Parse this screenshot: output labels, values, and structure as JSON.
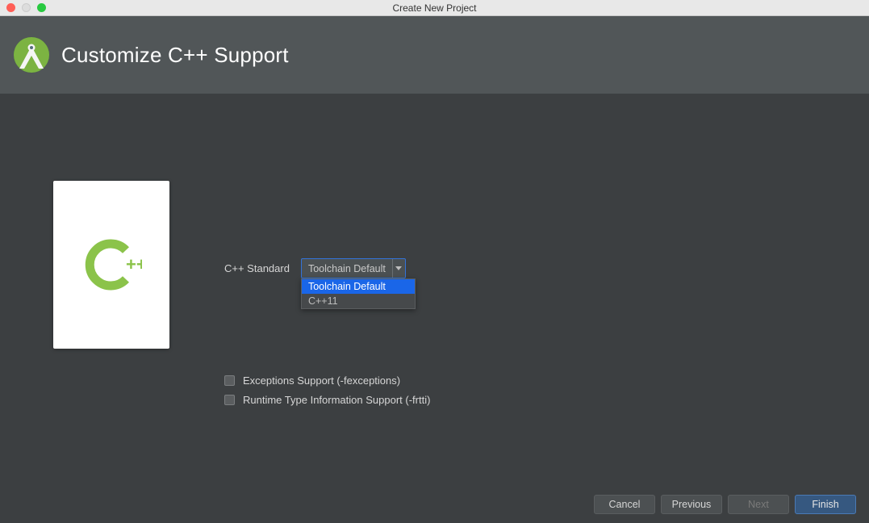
{
  "window": {
    "title": "Create New Project"
  },
  "header": {
    "title": "Customize C++ Support"
  },
  "form": {
    "standard_label": "C++ Standard",
    "standard_value": "Toolchain Default",
    "standard_options": [
      "Toolchain Default",
      "C++11"
    ]
  },
  "checkboxes": {
    "exceptions": "Exceptions Support (-fexceptions)",
    "rtti": "Runtime Type Information Support (-frtti)"
  },
  "buttons": {
    "cancel": "Cancel",
    "previous": "Previous",
    "next": "Next",
    "finish": "Finish"
  },
  "icons": {
    "cpp_label": "++"
  }
}
